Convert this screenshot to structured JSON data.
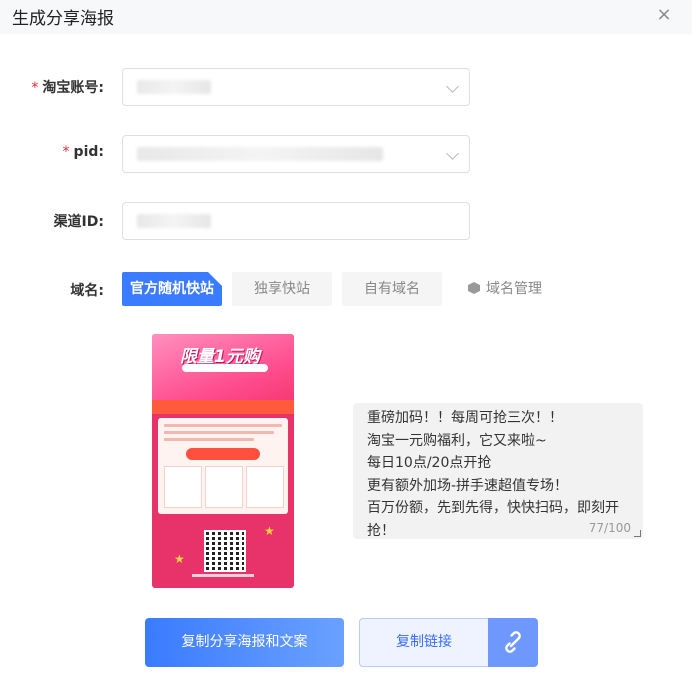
{
  "dialog": {
    "title": "生成分享海报",
    "close_glyph": "×"
  },
  "form": {
    "account": {
      "label": "淘宝账号:",
      "required_mark": "*"
    },
    "pid": {
      "label": "pid:",
      "required_mark": "*"
    },
    "channel": {
      "label": "渠道ID:"
    },
    "domain": {
      "label": "域名:",
      "options": [
        {
          "label": "官方随机快站",
          "selected": true
        },
        {
          "label": "独享快站",
          "selected": false
        },
        {
          "label": "自有域名",
          "selected": false
        }
      ],
      "manage_label": "域名管理"
    }
  },
  "poster": {
    "headline": "限量1元购"
  },
  "share_text": {
    "lines": [
      "重磅加码！！每周可抢三次！！",
      "淘宝一元购福利，它又来啦~",
      "每日10点/20点开抢",
      "更有额外加场-拼手速超值专场！",
      "百万份额，先到先得，快快扫码，即刻开抢！"
    ],
    "count": "77/100"
  },
  "actions": {
    "copy_poster": "复制分享海报和文案",
    "copy_link": "复制链接"
  },
  "colors": {
    "primary": "#3a7bff",
    "required": "#f5222d"
  },
  "icons": {
    "close": "close-icon",
    "dropdown": "chevron-down-icon",
    "manage": "hexagon-icon",
    "link": "link-icon"
  }
}
